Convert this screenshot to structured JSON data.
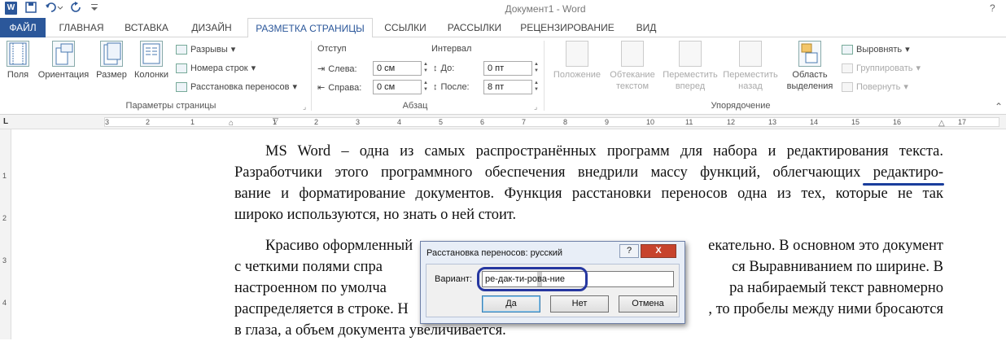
{
  "titlebar": {
    "app_icon": "W",
    "document_title": "Документ1 - Word",
    "help_label": "?"
  },
  "tabs": [
    {
      "label": "ФАЙЛ"
    },
    {
      "label": "ГЛАВНАЯ"
    },
    {
      "label": "ВСТАВКА"
    },
    {
      "label": "ДИЗАЙН"
    },
    {
      "label": "РАЗМЕТКА СТРАНИЦЫ"
    },
    {
      "label": "ССЫЛКИ"
    },
    {
      "label": "РАССЫЛКИ"
    },
    {
      "label": "РЕЦЕНЗИРОВАНИЕ"
    },
    {
      "label": "ВИД"
    }
  ],
  "ribbon": {
    "page_setup": {
      "margins": "Поля",
      "orientation": "Ориентация",
      "size": "Размер",
      "columns": "Колонки",
      "breaks": "Разрывы",
      "line_numbers": "Номера строк",
      "hyphenation": "Расстановка переносов",
      "group_label": "Параметры страницы"
    },
    "paragraph": {
      "indent_title": "Отступ",
      "spacing_title": "Интервал",
      "left_label": "Слева:",
      "left_value": "0 см",
      "right_label": "Справа:",
      "right_value": "0 см",
      "before_label": "До:",
      "before_value": "0 пт",
      "after_label": "После:",
      "after_value": "8 пт",
      "group_label": "Абзац"
    },
    "arrange": {
      "position_l1": "Положение",
      "wrap_l1": "Обтекание",
      "wrap_l2": "текстом",
      "forward_l1": "Переместить",
      "forward_l2": "вперед",
      "backward_l1": "Переместить",
      "backward_l2": "назад",
      "selection_l1": "Область",
      "selection_l2": "выделения",
      "align": "Выровнять",
      "group": "Группировать",
      "rotate": "Повернуть",
      "group_label": "Упорядочение"
    }
  },
  "ruler": {
    "numbers": [
      "3",
      "2",
      "1",
      "1",
      "2",
      "3",
      "4",
      "5",
      "6",
      "7",
      "8",
      "9",
      "10",
      "11",
      "12",
      "13",
      "14",
      "15",
      "16",
      "17"
    ],
    "vertical_numbers": [
      "1",
      "2",
      "3",
      "4"
    ],
    "corner": "L"
  },
  "document": {
    "para1_l1": "MS Word – одна из самых распространённых программ для набора и редактирования текста.",
    "para1_l2": "Разработчики этого программного обеспечения внедрили массу функций, облегчающих редактиро-",
    "para1_l3": "вание и форматирование документов. Функция расстановки переносов одна из тех, которые не так",
    "para1_l4": "широко используются, но знать о ней стоит.",
    "para2_l1": "Красиво оформленный",
    "para2_l1b": "екательно. В основном это документ",
    "para2_l2": "с четкими полями спра",
    "para2_l2b": "ся Выравниванием по ширине. В",
    "para2_l3": "настроенном по умолча",
    "para2_l3b": "ра набираемый текст равномерно",
    "para2_l4": "распределяется в строке. Н",
    "para2_l4b": ", то пробелы между ними бросаются",
    "para2_l5": "в глаза, а объем документа увеличивается."
  },
  "dialog": {
    "title": "Расстановка переносов: русский",
    "help": "?",
    "close": "X",
    "variant_label": "Вариант:",
    "variant_value_a": "ре-дак-ти-ро",
    "variant_value_b": "в",
    "variant_value_c": "а-ние",
    "yes": "Да",
    "no": "Нет",
    "cancel": "Отмена"
  },
  "colors": {
    "accent": "#2b579a",
    "annotation": "#1a3d9c",
    "close_red": "#c7432c"
  }
}
